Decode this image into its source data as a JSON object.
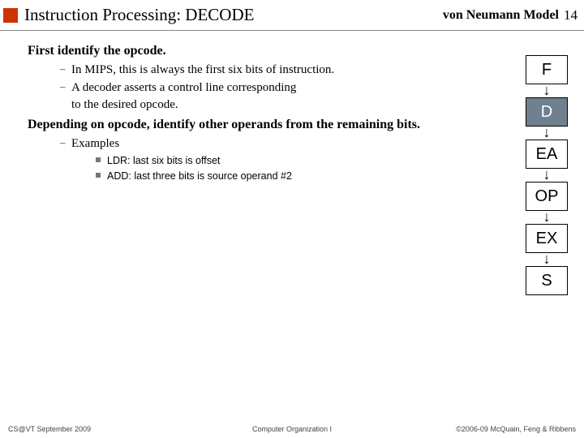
{
  "header": {
    "title": "Instruction Processing: DECODE",
    "model": "von Neumann Model",
    "page": "14"
  },
  "section1": {
    "head": "First identify the opcode.",
    "b1": "In MIPS, this is always the first six bits of instruction.",
    "b2a": "A decoder asserts a control line corresponding",
    "b2b": "to the desired opcode."
  },
  "section2": {
    "head": "Depending on opcode, identify other operands from the remaining bits.",
    "ex_label": "Examples",
    "ex1": "LDR: last six bits is offset",
    "ex2": "ADD: last three bits is source operand #2"
  },
  "pipeline": {
    "s0": "F",
    "s1": "D",
    "s2": "EA",
    "s3": "OP",
    "s4": "EX",
    "s5": "S"
  },
  "footer": {
    "left": "CS@VT September 2009",
    "center": "Computer Organization I",
    "right": "©2006-09  McQuain, Feng & Ribbens"
  }
}
